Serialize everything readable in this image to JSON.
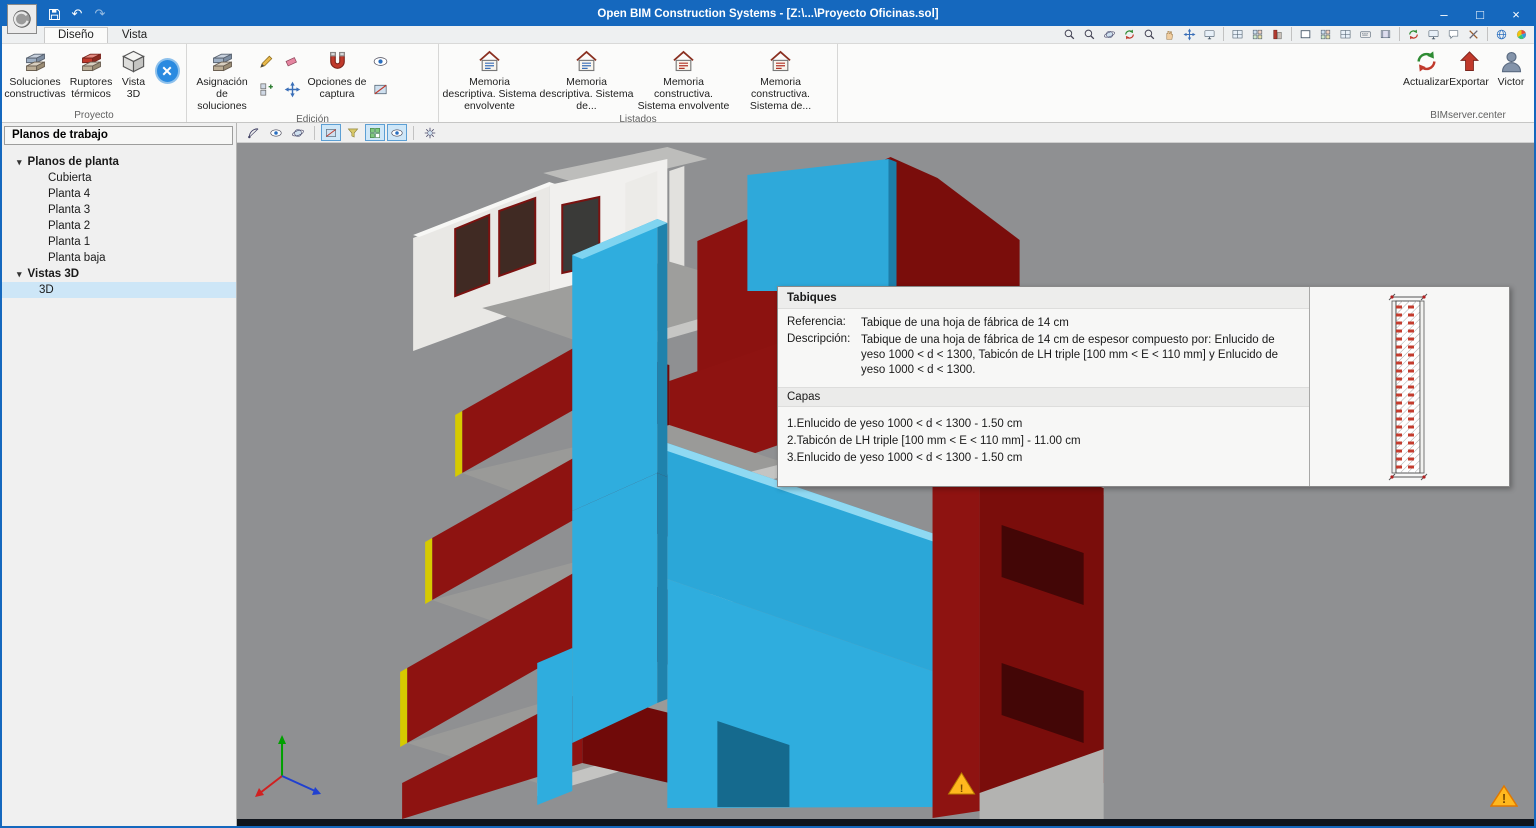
{
  "window": {
    "title": "Open BIM Construction Systems - [Z:\\...\\Proyecto Oficinas.sol]",
    "controls": {
      "minimize": "–",
      "maximize": "□",
      "close": "×"
    },
    "quick_access": {
      "undo": "↶",
      "redo": "↷"
    }
  },
  "tabs": [
    {
      "label": "Diseño"
    },
    {
      "label": "Vista"
    }
  ],
  "ribbon": {
    "proyecto": {
      "label": "Proyecto",
      "buttons": [
        "Soluciones constructivas",
        "Ruptores térmicos",
        "Vista 3D"
      ]
    },
    "edicion": {
      "label": "Edición",
      "buttons": [
        "Asignación de soluciones",
        "Opciones de captura"
      ]
    },
    "listados": {
      "label": "Listados",
      "buttons": [
        "Memoria descriptiva. Sistema envolvente",
        "Memoria descriptiva. Sistema de...",
        "Memoria constructiva. Sistema envolvente",
        "Memoria constructiva. Sistema de..."
      ]
    },
    "bimserver": {
      "label": "BIMserver.center",
      "buttons": [
        "Actualizar",
        "Exportar",
        "Victor"
      ]
    }
  },
  "sidebar": {
    "title": "Planos de trabajo",
    "collapse_glyph": "▾",
    "tree": [
      {
        "label": "Planos de planta"
      },
      {
        "label": "Cubierta"
      },
      {
        "label": "Planta 4"
      },
      {
        "label": "Planta 3"
      },
      {
        "label": "Planta 2"
      },
      {
        "label": "Planta 1"
      },
      {
        "label": "Planta baja"
      },
      {
        "label": "Vistas 3D"
      },
      {
        "label": "3D"
      }
    ]
  },
  "tooltip": {
    "title": "Tabiques",
    "referencia_label": "Referencia:",
    "referencia": "Tabique de una hoja de fábrica de 14 cm",
    "descripcion_label": "Descripción:",
    "descripcion": "Tabique de una hoja de fábrica de 14 cm de espesor compuesto por: Enlucido de yeso 1000 < d < 1300, Tabicón de LH triple [100 mm < E < 110 mm] y Enlucido de yeso 1000 < d < 1300.",
    "capas_label": "Capas",
    "capas": [
      "1.Enlucido de yeso 1000 < d < 1300 - 1.50 cm",
      "2.Tabicón de LH triple [100 mm < E < 110 mm] - 11.00 cm",
      "3.Enlucido de yeso 1000 < d < 1300 - 1.50 cm"
    ]
  },
  "colors": {
    "titlebar": "#1568be",
    "canvas": "#8f9092",
    "selection": "#cde6f7",
    "wall_red": "#8e1311",
    "partition_cyan": "#2fadde",
    "warning": "#ffb81e"
  }
}
